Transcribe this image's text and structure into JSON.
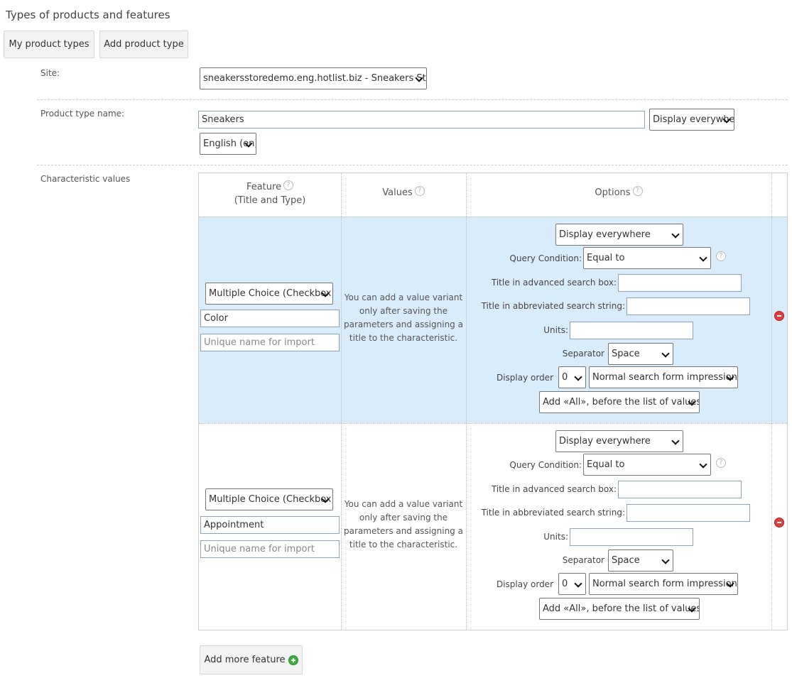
{
  "page": {
    "title": "Types of products and features"
  },
  "tabs": [
    {
      "label": "My product types"
    },
    {
      "label": "Add product type"
    }
  ],
  "form": {
    "site_label": "Site:",
    "site_value": "sneakersstoredemo.eng.hotlist.biz - Sneakers Store",
    "type_name_label": "Product type name:",
    "type_name_value": "Sneakers",
    "display_value": "Display everywhere",
    "language_value": "English (en)",
    "characteristics_label": "Characteristic values"
  },
  "table": {
    "headers": {
      "feature": "Feature",
      "feature_sub": "(Title and Type)",
      "values": "Values",
      "options": "Options"
    },
    "help_glyph": "?",
    "rows": [
      {
        "type_value": "Multiple Choice (Checkbox)",
        "title_value": "Color",
        "import_placeholder": "Unique name for import",
        "note_lines": [
          "You can add a value variant",
          "only after saving the",
          "parameters and assigning a",
          "title to the characteristic."
        ],
        "display_value": "Display everywhere",
        "query_label": "Query Condition:",
        "query_value": "Equal to",
        "adv_title_label": "Title in advanced search box:",
        "abbr_title_label": "Title in abbreviated search string:",
        "units_label": "Units:",
        "separator_label": "Separator",
        "separator_value": "Space",
        "order_label": "Display order",
        "order_value": "0",
        "impression_value": "Normal search form impression",
        "all_value": "Add «All», before the list of values"
      },
      {
        "type_value": "Multiple Choice (Checkbox)",
        "title_value": "Appointment",
        "import_placeholder": "Unique name for import",
        "note_lines": [
          "You can add a value variant",
          "only after saving the",
          "parameters and assigning a",
          "title to the characteristic."
        ],
        "display_value": "Display everywhere",
        "query_label": "Query Condition:",
        "query_value": "Equal to",
        "adv_title_label": "Title in advanced search box:",
        "abbr_title_label": "Title in abbreviated search string:",
        "units_label": "Units:",
        "separator_label": "Separator",
        "separator_value": "Space",
        "order_label": "Display order",
        "order_value": "0",
        "impression_value": "Normal search form impression",
        "all_value": "Add «All», before the list of values"
      }
    ]
  },
  "add_more_label": "Add more feature",
  "colors": {
    "row_highlight": "#d9ecfb",
    "remove": "#e04040",
    "add": "#3fae3f"
  }
}
